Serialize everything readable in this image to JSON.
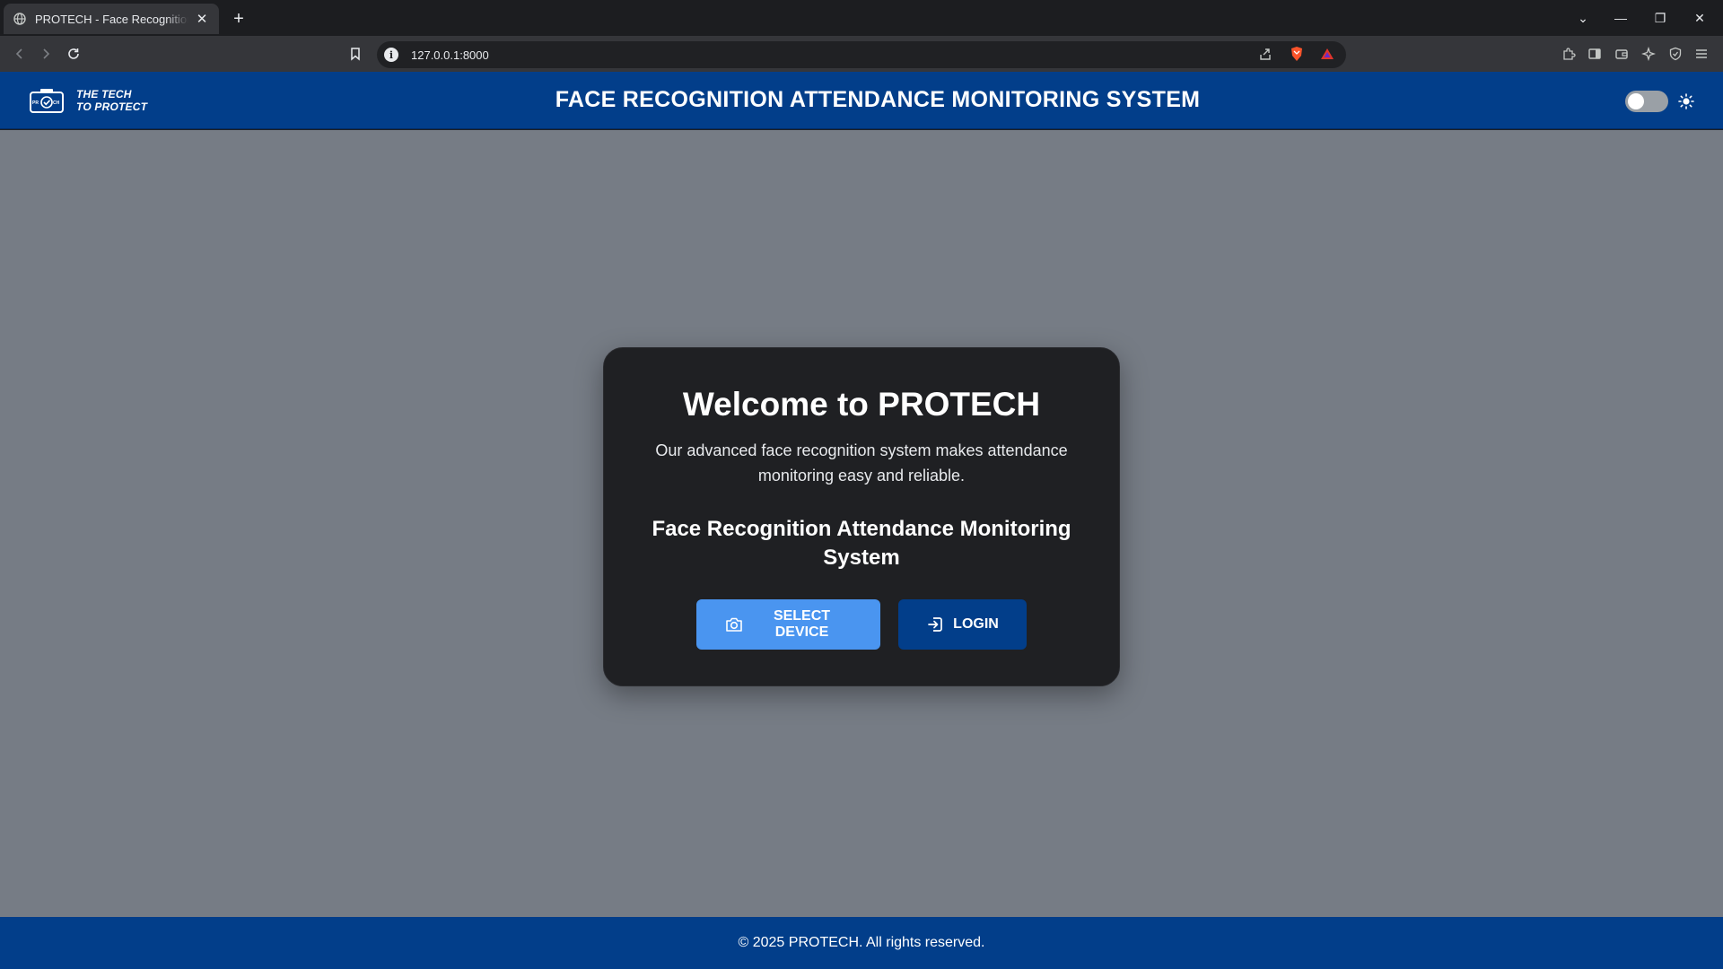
{
  "browser": {
    "tab_title": "PROTECH - Face Recognition Attendance Monitoring System",
    "tab_close": "✕",
    "new_tab": "+",
    "url": "127.0.0.1:8000",
    "window_controls": [
      "⌄",
      "—",
      "❐",
      "✕"
    ]
  },
  "header": {
    "tagline_line1": "THE TECH",
    "tagline_line2": "TO PROTECT",
    "title": "FACE RECOGNITION ATTENDANCE MONITORING SYSTEM",
    "theme_toggle_on": false
  },
  "card": {
    "heading": "Welcome to PROTECH",
    "description": "Our advanced face recognition system makes attendance monitoring easy and reliable.",
    "subheading": "Face Recognition Attendance Monitoring System",
    "select_device_label": "SELECT DEVICE",
    "login_label": "LOGIN"
  },
  "footer": {
    "text": "© 2025 PROTECH. All rights reserved."
  },
  "colors": {
    "brand_blue": "#023e8a",
    "button_light_blue": "#4a95f0",
    "main_background": "#767c85",
    "card_background": "#1f2023"
  }
}
